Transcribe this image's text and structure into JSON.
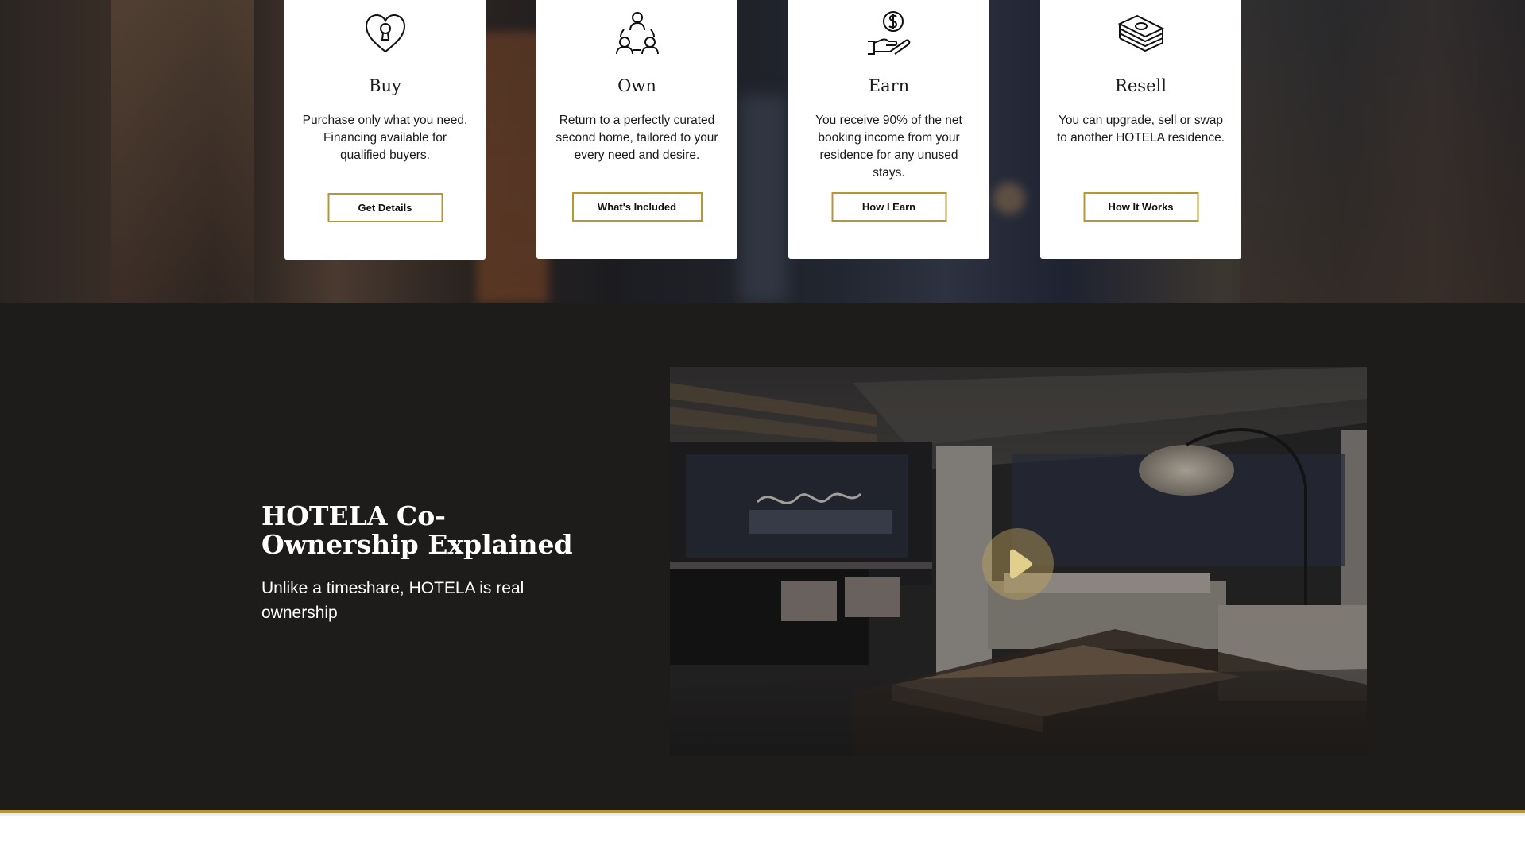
{
  "hero": {
    "cards": [
      {
        "icon": "heart-keyhole-icon",
        "title": "Buy",
        "description": "Purchase only what you need. Financing available for qualified buyers.",
        "button": "Get Details"
      },
      {
        "icon": "people-circle-icon",
        "title": "Own",
        "description": "Return to a perfectly curated second home, tailored to your every need and desire.",
        "button": "What's Included"
      },
      {
        "icon": "hand-coin-icon",
        "title": "Earn",
        "description": "You receive 90% of the net booking income from your residence for any unused stays.",
        "button": "How I Earn"
      },
      {
        "icon": "money-stack-icon",
        "title": "Resell",
        "description": "You can upgrade, sell or swap to another HOTELA residence.",
        "button": "How It Works"
      }
    ]
  },
  "video_section": {
    "heading": "HOTELA Co-Ownership Explained",
    "subheading": "Unlike a timeshare, HOTELA is real ownership",
    "play_icon": "play-icon"
  },
  "colors": {
    "accent_gold": "#b8972f",
    "dark_background": "#1d1c1b"
  }
}
